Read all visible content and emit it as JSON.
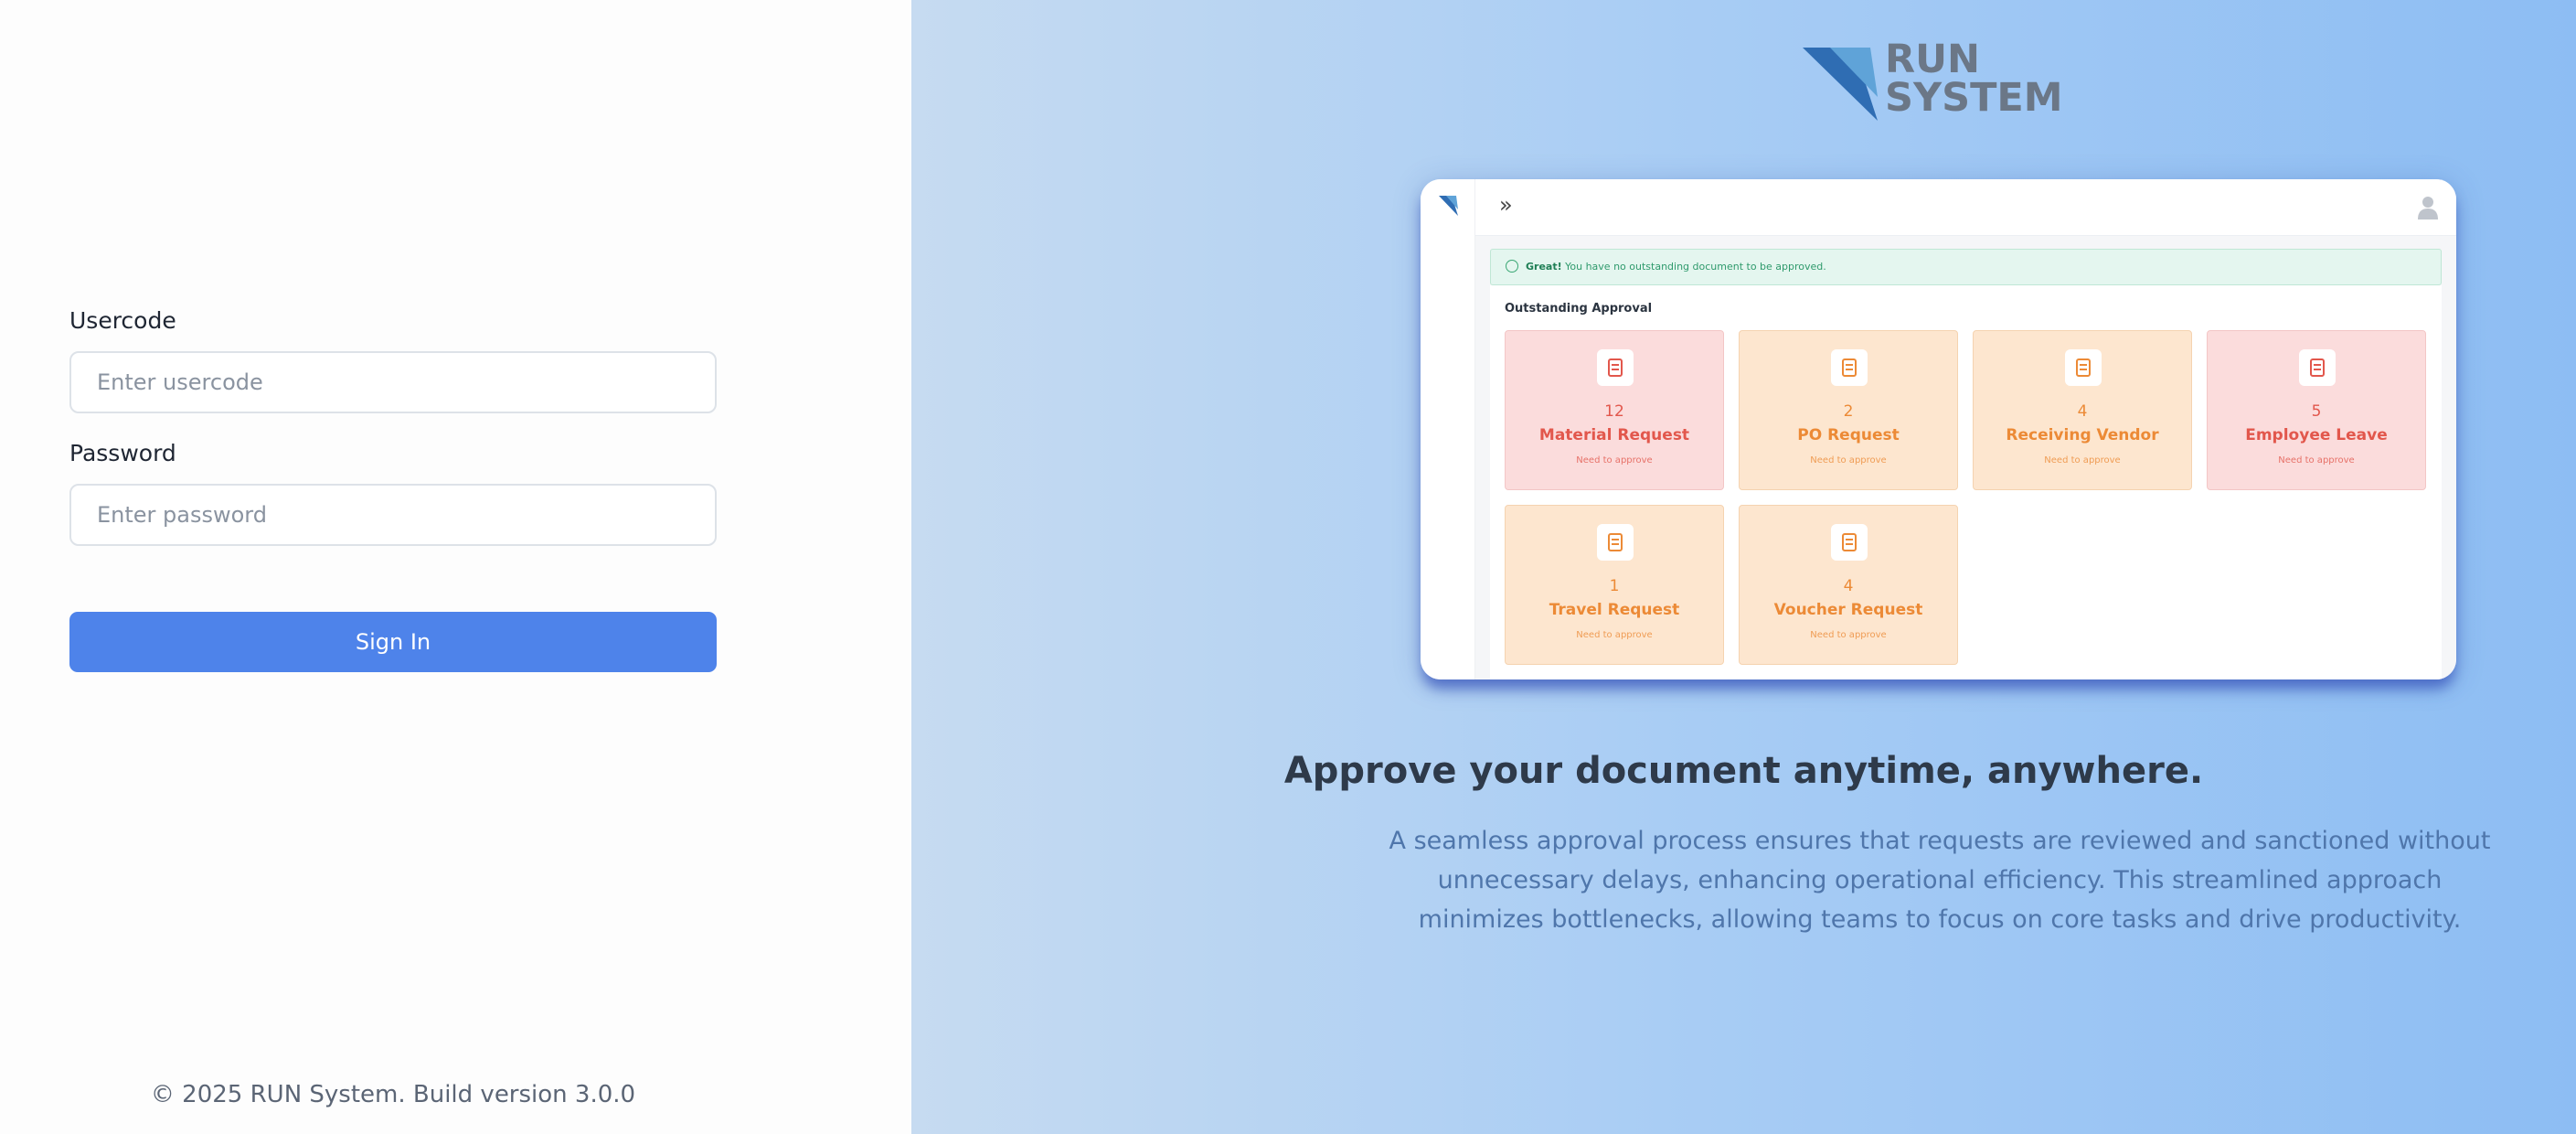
{
  "login": {
    "usercode_label": "Usercode",
    "usercode_placeholder": "Enter usercode",
    "password_label": "Password",
    "password_placeholder": "Enter password",
    "signin_label": "Sign In",
    "footer": "© 2025 RUN System. Build version 3.0.0"
  },
  "brand": {
    "line1": "RUN",
    "line2": "SYSTEM",
    "colors": {
      "mark_dark": "#2f6db3",
      "mark_light": "#5fa3d8",
      "text": "#6b7787"
    }
  },
  "preview": {
    "expand_icon": "»",
    "alert_strong": "Great!",
    "alert_text": "You have no outstanding document to be approved.",
    "section_title": "Outstanding Approval",
    "cards": [
      {
        "count": "12",
        "title": "Material Request",
        "sub": "Need to approve",
        "tone": "red"
      },
      {
        "count": "2",
        "title": "PO Request",
        "sub": "Need to approve",
        "tone": "orange"
      },
      {
        "count": "4",
        "title": "Receiving Vendor",
        "sub": "Need to approve",
        "tone": "orange"
      },
      {
        "count": "5",
        "title": "Employee Leave",
        "sub": "Need to approve",
        "tone": "red"
      },
      {
        "count": "1",
        "title": "Travel Request",
        "sub": "Need to approve",
        "tone": "orange"
      },
      {
        "count": "4",
        "title": "Voucher Request",
        "sub": "Need to approve",
        "tone": "orange"
      }
    ]
  },
  "promo": {
    "headline": "Approve your document anytime, anywhere.",
    "description": "A seamless approval process ensures that requests are reviewed and sanctioned without unnecessary delays, enhancing operational efficiency. This streamlined approach minimizes bottlenecks, allowing teams to focus on core tasks and drive productivity."
  },
  "colors": {
    "accent": "#4e83ea",
    "card_red_bg": "#fbdcdc",
    "card_orange_bg": "#fde6cf"
  }
}
